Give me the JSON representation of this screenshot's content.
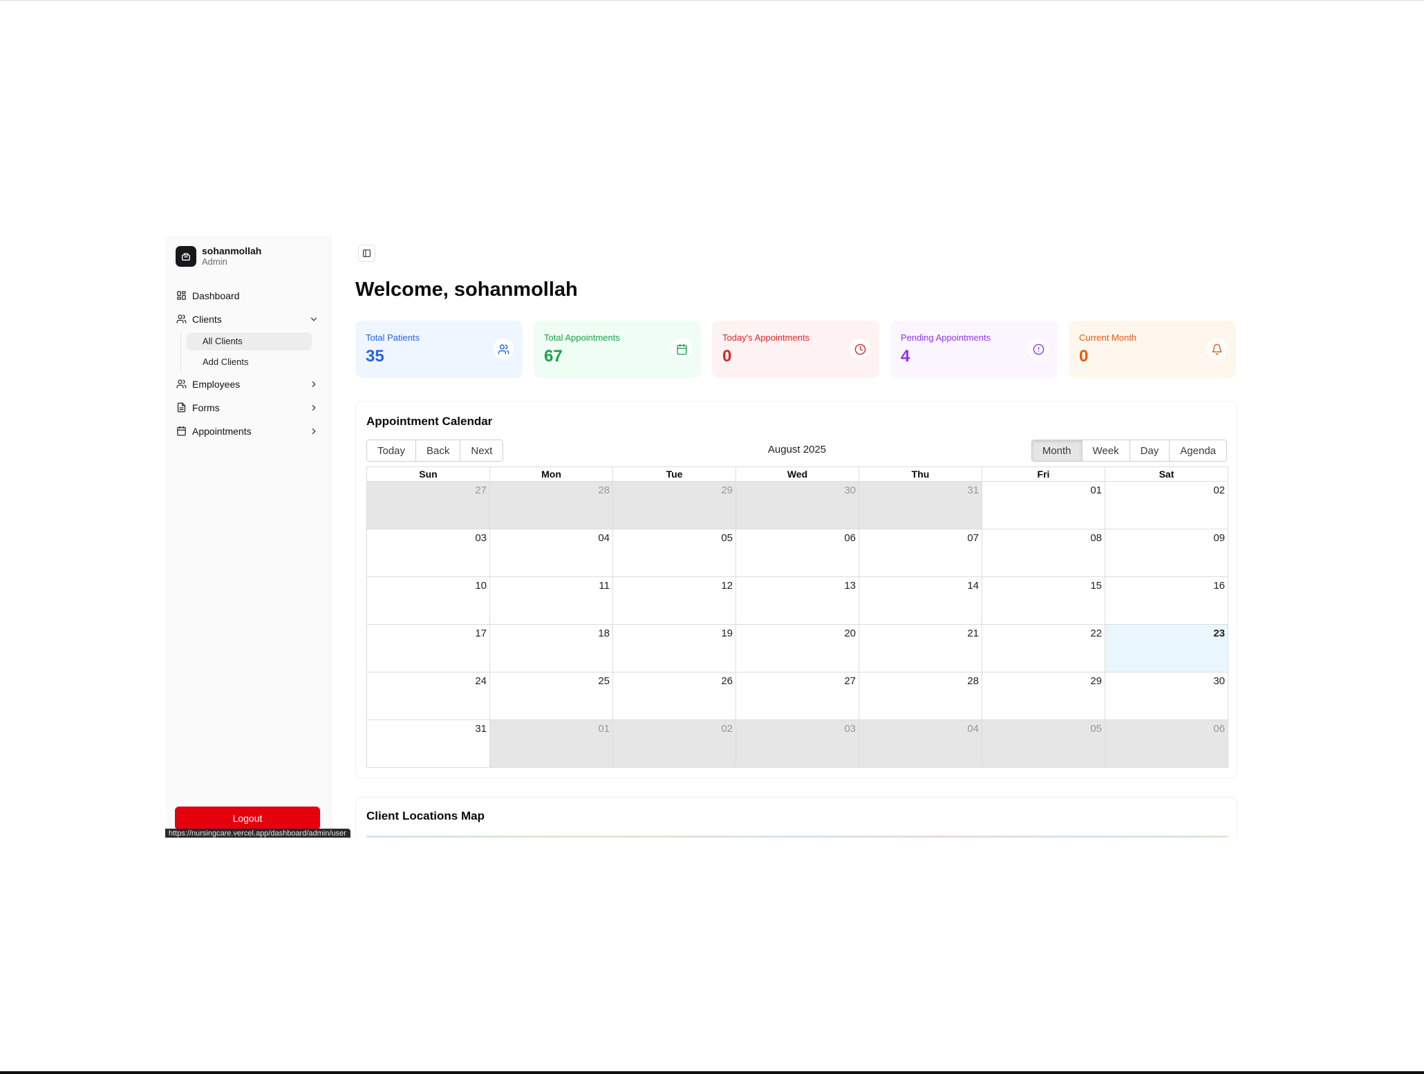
{
  "user": {
    "name": "sohanmollah",
    "role": "Admin"
  },
  "nav": {
    "dashboard": "Dashboard",
    "clients": "Clients",
    "clients_sub": [
      "All Clients",
      "Add Clients"
    ],
    "employees": "Employees",
    "forms": "Forms",
    "appointments": "Appointments"
  },
  "logout_label": "Logout",
  "status_url": "https://nursingcare.vercel.app/dashboard/admin/user",
  "welcome": "Welcome, sohanmollah",
  "stats": [
    {
      "label": "Total Patients",
      "value": "35",
      "color": "#2563eb",
      "bg": "#eff6ff",
      "icon": "users-icon"
    },
    {
      "label": "Total Appointments",
      "value": "67",
      "color": "#16a34a",
      "bg": "#f0fdf4",
      "icon": "calendar-icon"
    },
    {
      "label": "Today's Appointments",
      "value": "0",
      "color": "#dc2626",
      "bg": "#fef2f2",
      "icon": "clock-icon"
    },
    {
      "label": "Pending Appointments",
      "value": "4",
      "color": "#9333ea",
      "bg": "#faf5ff",
      "icon": "alert-circle-icon"
    },
    {
      "label": "Current Month",
      "value": "0",
      "color": "#ea580c",
      "bg": "#fff7ed",
      "icon": "bell-icon"
    }
  ],
  "calendar": {
    "title": "Appointment Calendar",
    "label": "August 2025",
    "nav_buttons": [
      "Today",
      "Back",
      "Next"
    ],
    "views": [
      "Month",
      "Week",
      "Day",
      "Agenda"
    ],
    "active_view": "Month",
    "weekdays": [
      "Sun",
      "Mon",
      "Tue",
      "Wed",
      "Thu",
      "Fri",
      "Sat"
    ],
    "weeks": [
      [
        "27",
        "28",
        "29",
        "30",
        "31",
        "01",
        "02"
      ],
      [
        "03",
        "04",
        "05",
        "06",
        "07",
        "08",
        "09"
      ],
      [
        "10",
        "11",
        "12",
        "13",
        "14",
        "15",
        "16"
      ],
      [
        "17",
        "18",
        "19",
        "20",
        "21",
        "22",
        "23"
      ],
      [
        "24",
        "25",
        "26",
        "27",
        "28",
        "29",
        "30"
      ],
      [
        "31",
        "01",
        "02",
        "03",
        "04",
        "05",
        "06"
      ]
    ],
    "off_range": [
      [
        0,
        0
      ],
      [
        0,
        1
      ],
      [
        0,
        2
      ],
      [
        0,
        3
      ],
      [
        0,
        4
      ],
      [
        5,
        1
      ],
      [
        5,
        2
      ],
      [
        5,
        3
      ],
      [
        5,
        4
      ],
      [
        5,
        5
      ],
      [
        5,
        6
      ]
    ],
    "today": [
      3,
      6
    ]
  },
  "map": {
    "title": "Client Locations Map"
  }
}
